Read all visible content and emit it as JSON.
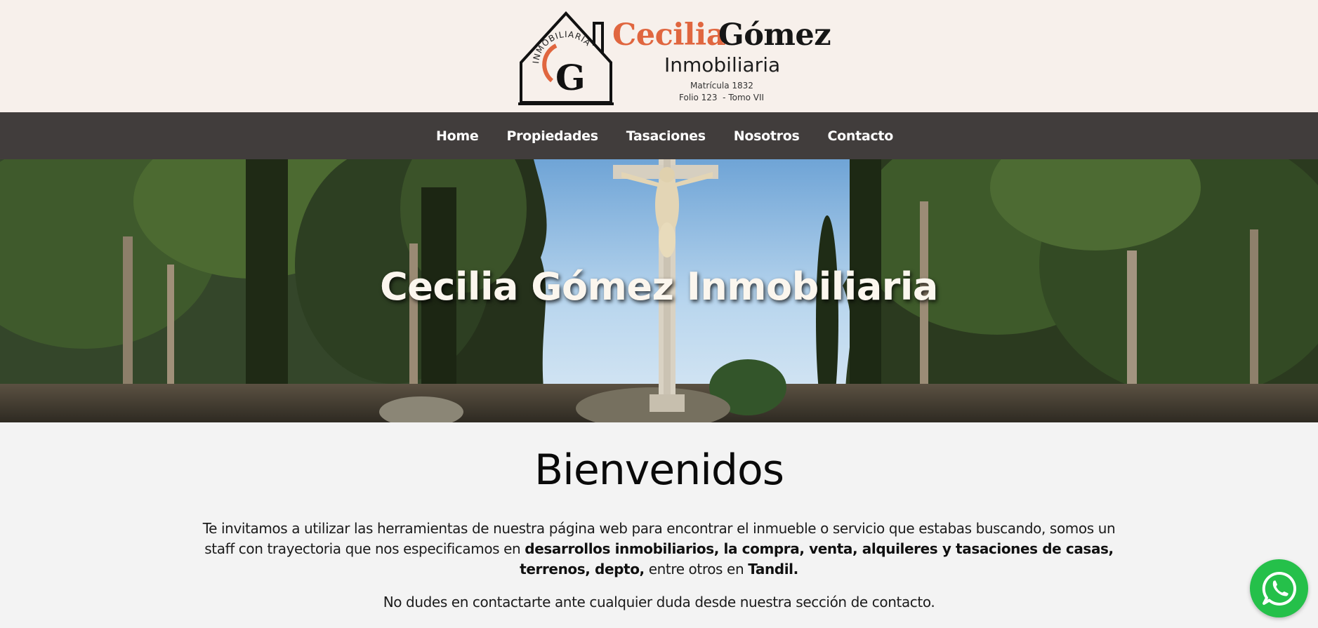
{
  "brand": {
    "first_name": "Cecilia",
    "last_name": "Gómez",
    "subtitle": "Inmobiliaria",
    "matricula": "Matrícula 1832",
    "folio": "Folio 123  - Tomo VII",
    "ring_text": "INMOBILIARIA",
    "monogram": "G",
    "accent_color": "#e0663f"
  },
  "nav": {
    "items": [
      {
        "label": "Home"
      },
      {
        "label": "Propiedades"
      },
      {
        "label": "Tasaciones"
      },
      {
        "label": "Nosotros"
      },
      {
        "label": "Contacto"
      }
    ]
  },
  "hero": {
    "title": "Cecilia Gómez Inmobiliaria"
  },
  "welcome": {
    "heading": "Bienvenidos",
    "p1_a": "Te invitamos a utilizar las herramientas de nuestra página web para encontrar el inmueble o servicio que estabas buscando, somos un staff con trayectoria que nos especificamos en ",
    "p1_b": "desarrollos inmobiliarios, la compra, venta, alquileres y tasaciones de casas, terrenos, depto,",
    "p1_c": " entre otros en ",
    "p1_d": "Tandil.",
    "p2": "No dudes en contactarte ante cualquier duda desde nuestra sección de contacto."
  },
  "whatsapp": {
    "icon": "whatsapp-icon",
    "color": "#25c04a"
  }
}
